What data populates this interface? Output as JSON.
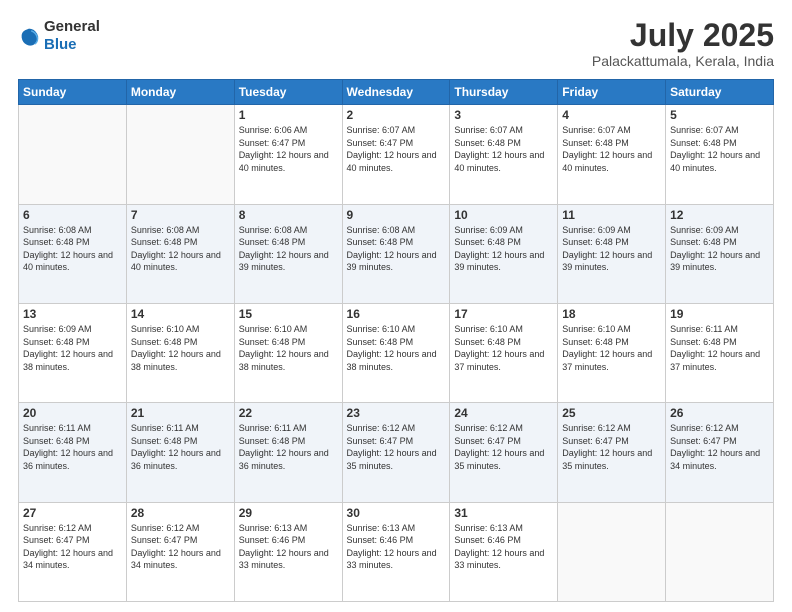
{
  "logo": {
    "general": "General",
    "blue": "Blue"
  },
  "title": "July 2025",
  "subtitle": "Palackattumala, Kerala, India",
  "days_of_week": [
    "Sunday",
    "Monday",
    "Tuesday",
    "Wednesday",
    "Thursday",
    "Friday",
    "Saturday"
  ],
  "weeks": [
    [
      {
        "day": "",
        "info": ""
      },
      {
        "day": "",
        "info": ""
      },
      {
        "day": "1",
        "info": "Sunrise: 6:06 AM\nSunset: 6:47 PM\nDaylight: 12 hours and 40 minutes."
      },
      {
        "day": "2",
        "info": "Sunrise: 6:07 AM\nSunset: 6:47 PM\nDaylight: 12 hours and 40 minutes."
      },
      {
        "day": "3",
        "info": "Sunrise: 6:07 AM\nSunset: 6:48 PM\nDaylight: 12 hours and 40 minutes."
      },
      {
        "day": "4",
        "info": "Sunrise: 6:07 AM\nSunset: 6:48 PM\nDaylight: 12 hours and 40 minutes."
      },
      {
        "day": "5",
        "info": "Sunrise: 6:07 AM\nSunset: 6:48 PM\nDaylight: 12 hours and 40 minutes."
      }
    ],
    [
      {
        "day": "6",
        "info": "Sunrise: 6:08 AM\nSunset: 6:48 PM\nDaylight: 12 hours and 40 minutes."
      },
      {
        "day": "7",
        "info": "Sunrise: 6:08 AM\nSunset: 6:48 PM\nDaylight: 12 hours and 40 minutes."
      },
      {
        "day": "8",
        "info": "Sunrise: 6:08 AM\nSunset: 6:48 PM\nDaylight: 12 hours and 39 minutes."
      },
      {
        "day": "9",
        "info": "Sunrise: 6:08 AM\nSunset: 6:48 PM\nDaylight: 12 hours and 39 minutes."
      },
      {
        "day": "10",
        "info": "Sunrise: 6:09 AM\nSunset: 6:48 PM\nDaylight: 12 hours and 39 minutes."
      },
      {
        "day": "11",
        "info": "Sunrise: 6:09 AM\nSunset: 6:48 PM\nDaylight: 12 hours and 39 minutes."
      },
      {
        "day": "12",
        "info": "Sunrise: 6:09 AM\nSunset: 6:48 PM\nDaylight: 12 hours and 39 minutes."
      }
    ],
    [
      {
        "day": "13",
        "info": "Sunrise: 6:09 AM\nSunset: 6:48 PM\nDaylight: 12 hours and 38 minutes."
      },
      {
        "day": "14",
        "info": "Sunrise: 6:10 AM\nSunset: 6:48 PM\nDaylight: 12 hours and 38 minutes."
      },
      {
        "day": "15",
        "info": "Sunrise: 6:10 AM\nSunset: 6:48 PM\nDaylight: 12 hours and 38 minutes."
      },
      {
        "day": "16",
        "info": "Sunrise: 6:10 AM\nSunset: 6:48 PM\nDaylight: 12 hours and 38 minutes."
      },
      {
        "day": "17",
        "info": "Sunrise: 6:10 AM\nSunset: 6:48 PM\nDaylight: 12 hours and 37 minutes."
      },
      {
        "day": "18",
        "info": "Sunrise: 6:10 AM\nSunset: 6:48 PM\nDaylight: 12 hours and 37 minutes."
      },
      {
        "day": "19",
        "info": "Sunrise: 6:11 AM\nSunset: 6:48 PM\nDaylight: 12 hours and 37 minutes."
      }
    ],
    [
      {
        "day": "20",
        "info": "Sunrise: 6:11 AM\nSunset: 6:48 PM\nDaylight: 12 hours and 36 minutes."
      },
      {
        "day": "21",
        "info": "Sunrise: 6:11 AM\nSunset: 6:48 PM\nDaylight: 12 hours and 36 minutes."
      },
      {
        "day": "22",
        "info": "Sunrise: 6:11 AM\nSunset: 6:48 PM\nDaylight: 12 hours and 36 minutes."
      },
      {
        "day": "23",
        "info": "Sunrise: 6:12 AM\nSunset: 6:47 PM\nDaylight: 12 hours and 35 minutes."
      },
      {
        "day": "24",
        "info": "Sunrise: 6:12 AM\nSunset: 6:47 PM\nDaylight: 12 hours and 35 minutes."
      },
      {
        "day": "25",
        "info": "Sunrise: 6:12 AM\nSunset: 6:47 PM\nDaylight: 12 hours and 35 minutes."
      },
      {
        "day": "26",
        "info": "Sunrise: 6:12 AM\nSunset: 6:47 PM\nDaylight: 12 hours and 34 minutes."
      }
    ],
    [
      {
        "day": "27",
        "info": "Sunrise: 6:12 AM\nSunset: 6:47 PM\nDaylight: 12 hours and 34 minutes."
      },
      {
        "day": "28",
        "info": "Sunrise: 6:12 AM\nSunset: 6:47 PM\nDaylight: 12 hours and 34 minutes."
      },
      {
        "day": "29",
        "info": "Sunrise: 6:13 AM\nSunset: 6:46 PM\nDaylight: 12 hours and 33 minutes."
      },
      {
        "day": "30",
        "info": "Sunrise: 6:13 AM\nSunset: 6:46 PM\nDaylight: 12 hours and 33 minutes."
      },
      {
        "day": "31",
        "info": "Sunrise: 6:13 AM\nSunset: 6:46 PM\nDaylight: 12 hours and 33 minutes."
      },
      {
        "day": "",
        "info": ""
      },
      {
        "day": "",
        "info": ""
      }
    ]
  ]
}
